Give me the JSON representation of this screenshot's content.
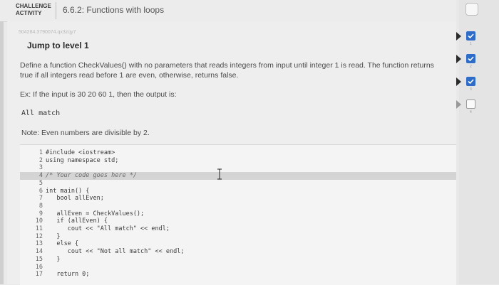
{
  "header": {
    "badge_line1": "CHALLENGE",
    "badge_line2": "ACTIVITY",
    "title": "6.6.2: Functions with loops"
  },
  "activity_id": "504284.3790074.qx3zqy7",
  "jump_label": "Jump to level 1",
  "description": "Define a function CheckValues() with no parameters that reads integers from input until integer 1 is read. The function returns true if all integers read before 1 are even, otherwise, returns false.",
  "example": "Ex: If the input is 30 20 60 1, then the output is:",
  "output": "All match",
  "note": "Note: Even numbers are divisible by 2.",
  "code": {
    "lines": [
      {
        "num": "1",
        "text": "#include <iostream>"
      },
      {
        "num": "2",
        "text": "using namespace std;"
      },
      {
        "num": "3",
        "text": ""
      },
      {
        "num": "4",
        "text": "/* Your code goes here */"
      },
      {
        "num": "5",
        "text": ""
      },
      {
        "num": "6",
        "text": "int main() {"
      },
      {
        "num": "7",
        "text": "   bool allEven;"
      },
      {
        "num": "8",
        "text": ""
      },
      {
        "num": "9",
        "text": "   allEven = CheckValues();"
      },
      {
        "num": "10",
        "text": "   if (allEven) {"
      },
      {
        "num": "11",
        "text": "      cout << \"All match\" << endl;"
      },
      {
        "num": "12",
        "text": "   }"
      },
      {
        "num": "13",
        "text": "   else {"
      },
      {
        "num": "14",
        "text": "      cout << \"Not all match\" << endl;"
      },
      {
        "num": "15",
        "text": "   }"
      },
      {
        "num": "16",
        "text": ""
      },
      {
        "num": "17",
        "text": "   return 0;"
      }
    ]
  },
  "levels": [
    {
      "num": "1",
      "state": "checked"
    },
    {
      "num": "2",
      "state": "checked"
    },
    {
      "num": "3",
      "state": "checked"
    },
    {
      "num": "4",
      "state": "unchecked"
    }
  ],
  "colors": {
    "accent": "#2f6cc8",
    "background": "#eeeeee"
  }
}
